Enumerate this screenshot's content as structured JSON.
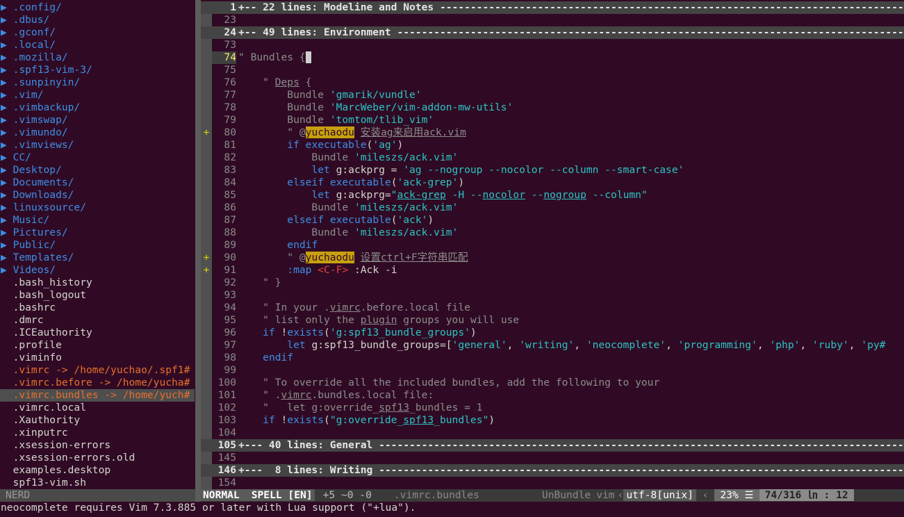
{
  "tree": [
    {
      "t": "▶ .config/",
      "k": "dir"
    },
    {
      "t": "▶ .dbus/",
      "k": "dir"
    },
    {
      "t": "▶ .gconf/",
      "k": "dir"
    },
    {
      "t": "▶ .local/",
      "k": "dir"
    },
    {
      "t": "▶ .mozilla/",
      "k": "dir"
    },
    {
      "t": "▶ .spf13-vim-3/",
      "k": "dir"
    },
    {
      "t": "▶ .sunpinyin/",
      "k": "dir"
    },
    {
      "t": "▶ .vim/",
      "k": "dir"
    },
    {
      "t": "▶ .vimbackup/",
      "k": "dir"
    },
    {
      "t": "▶ .vimswap/",
      "k": "dir"
    },
    {
      "t": "▶ .vimundo/",
      "k": "dir"
    },
    {
      "t": "▶ .vimviews/",
      "k": "dir"
    },
    {
      "t": "▶ CC/",
      "k": "dir"
    },
    {
      "t": "▶ Desktop/",
      "k": "dir"
    },
    {
      "t": "▶ Documents/",
      "k": "dir"
    },
    {
      "t": "▶ Downloads/",
      "k": "dir"
    },
    {
      "t": "▶ linuxsource/",
      "k": "dir"
    },
    {
      "t": "▶ Music/",
      "k": "dir"
    },
    {
      "t": "▶ Pictures/",
      "k": "dir"
    },
    {
      "t": "▶ Public/",
      "k": "dir"
    },
    {
      "t": "▶ Templates/",
      "k": "dir"
    },
    {
      "t": "▶ Videos/",
      "k": "dir"
    },
    {
      "t": "  .bash_history",
      "k": "file"
    },
    {
      "t": "  .bash_logout",
      "k": "file"
    },
    {
      "t": "  .bashrc",
      "k": "file"
    },
    {
      "t": "  .dmrc",
      "k": "file"
    },
    {
      "t": "  .ICEauthority",
      "k": "file"
    },
    {
      "t": "  .profile",
      "k": "file"
    },
    {
      "t": "  .viminfo",
      "k": "file"
    },
    {
      "t": "  .vimrc -> /home/yuchao/.spf1#",
      "k": "lnk"
    },
    {
      "t": "  .vimrc.before -> /home/yucha#",
      "k": "lnk"
    },
    {
      "t": "  .vimrc.bundles -> /home/yuch#",
      "k": "lnk sel"
    },
    {
      "t": "  .vimrc.local",
      "k": "file"
    },
    {
      "t": "  .Xauthority",
      "k": "file"
    },
    {
      "t": "  .xinputrc",
      "k": "file"
    },
    {
      "t": "  .xsession-errors",
      "k": "file"
    },
    {
      "t": "  .xsession-errors.old",
      "k": "file"
    },
    {
      "t": "  examples.desktop",
      "k": "file"
    },
    {
      "t": "  spf13-vim.sh",
      "k": "file"
    }
  ],
  "editor": [
    {
      "n": "1",
      "k": "fold",
      "s": "",
      "h": [
        [
          "+-- 22 lines: Modeline and Notes --------------------------------------------------------------------------------------------------------",
          ""
        ]
      ]
    },
    {
      "n": "23",
      "k": "",
      "s": "",
      "h": []
    },
    {
      "n": "24",
      "k": "fold",
      "s": "",
      "h": [
        [
          "+-- 49 lines: Environment ---------------------------------------------------------------------------------------------------------------",
          ""
        ]
      ]
    },
    {
      "n": "73",
      "k": "",
      "s": "",
      "h": []
    },
    {
      "n": "74",
      "k": "cur",
      "s": "",
      "h": [
        [
          "\" Bundles {",
          "cm"
        ],
        [
          " ",
          "cursor"
        ]
      ]
    },
    {
      "n": "75",
      "k": "",
      "s": "",
      "h": []
    },
    {
      "n": "76",
      "k": "",
      "s": "",
      "h": [
        [
          "    \" ",
          "cm"
        ],
        [
          "Deps",
          "cm ul"
        ],
        [
          " {",
          "cm"
        ]
      ]
    },
    {
      "n": "77",
      "k": "",
      "s": "",
      "h": [
        [
          "        Bundle ",
          "cm"
        ],
        [
          "'gmarik/vundle'",
          "st"
        ]
      ]
    },
    {
      "n": "78",
      "k": "",
      "s": "",
      "h": [
        [
          "        Bundle ",
          "cm"
        ],
        [
          "'MarcWeber/vim-addon-mw-utils'",
          "st"
        ]
      ]
    },
    {
      "n": "79",
      "k": "",
      "s": "",
      "h": [
        [
          "        Bundle ",
          "cm"
        ],
        [
          "'tomtom/tlib_vim'",
          "st"
        ]
      ]
    },
    {
      "n": "80",
      "k": "",
      "s": "+",
      "h": [
        [
          "        \" @",
          "cm"
        ],
        [
          "yuchaodu",
          "tag"
        ],
        [
          " ",
          "cm"
        ],
        [
          "安装ag来启用ack.vim",
          "cm ul"
        ]
      ]
    },
    {
      "n": "81",
      "k": "",
      "s": "",
      "h": [
        [
          "        ",
          ""
        ],
        [
          "if",
          "kw"
        ],
        [
          " ",
          ""
        ],
        [
          "executable",
          "kw"
        ],
        [
          "(",
          ""
        ],
        [
          "'ag'",
          "st"
        ],
        [
          ")",
          ""
        ]
      ]
    },
    {
      "n": "82",
      "k": "",
      "s": "",
      "h": [
        [
          "            Bundle ",
          "cm"
        ],
        [
          "'mileszs/ack.vim'",
          "st"
        ]
      ]
    },
    {
      "n": "83",
      "k": "",
      "s": "",
      "h": [
        [
          "            ",
          ""
        ],
        [
          "let",
          "kw"
        ],
        [
          " g:ackprg = ",
          ""
        ],
        [
          "'ag --nogroup --nocolor --column --smart-case'",
          "st"
        ]
      ]
    },
    {
      "n": "84",
      "k": "",
      "s": "",
      "h": [
        [
          "        ",
          ""
        ],
        [
          "elseif",
          "kw"
        ],
        [
          " ",
          ""
        ],
        [
          "executable",
          "kw"
        ],
        [
          "(",
          ""
        ],
        [
          "'ack-grep'",
          "st"
        ],
        [
          ")",
          ""
        ]
      ]
    },
    {
      "n": "85",
      "k": "",
      "s": "",
      "h": [
        [
          "            ",
          ""
        ],
        [
          "let",
          "kw"
        ],
        [
          " g:ackprg=",
          ""
        ],
        [
          "\"",
          "st"
        ],
        [
          "ack-grep",
          "st ul"
        ],
        [
          " -H --",
          "st"
        ],
        [
          "nocolor",
          "st ul"
        ],
        [
          " --",
          "st"
        ],
        [
          "nogroup",
          "st ul"
        ],
        [
          " --column\"",
          "st"
        ]
      ]
    },
    {
      "n": "86",
      "k": "",
      "s": "",
      "h": [
        [
          "            Bundle ",
          "cm"
        ],
        [
          "'mileszs/ack.vim'",
          "st"
        ]
      ]
    },
    {
      "n": "87",
      "k": "",
      "s": "",
      "h": [
        [
          "        ",
          ""
        ],
        [
          "elseif",
          "kw"
        ],
        [
          " ",
          ""
        ],
        [
          "executable",
          "kw"
        ],
        [
          "(",
          ""
        ],
        [
          "'ack'",
          "st"
        ],
        [
          ")",
          ""
        ]
      ]
    },
    {
      "n": "88",
      "k": "",
      "s": "",
      "h": [
        [
          "            Bundle ",
          "cm"
        ],
        [
          "'mileszs/ack.vim'",
          "st"
        ]
      ]
    },
    {
      "n": "89",
      "k": "",
      "s": "",
      "h": [
        [
          "        ",
          ""
        ],
        [
          "endif",
          "kw"
        ]
      ]
    },
    {
      "n": "90",
      "k": "",
      "s": "+",
      "h": [
        [
          "        \" @",
          "cm"
        ],
        [
          "yuchaodu",
          "tag"
        ],
        [
          " ",
          "cm"
        ],
        [
          "设置ctrl+F字符串匹配",
          "cm ul"
        ]
      ]
    },
    {
      "n": "91",
      "k": "",
      "s": "+",
      "h": [
        [
          "        ",
          ""
        ],
        [
          ":map",
          "kw"
        ],
        [
          " ",
          ""
        ],
        [
          "<C-F>",
          "key"
        ],
        [
          " :Ack -i",
          ""
        ]
      ]
    },
    {
      "n": "92",
      "k": "",
      "s": "",
      "h": [
        [
          "    \" }",
          "cm"
        ]
      ]
    },
    {
      "n": "93",
      "k": "",
      "s": "",
      "h": []
    },
    {
      "n": "94",
      "k": "",
      "s": "",
      "h": [
        [
          "    \" In your .",
          "cm"
        ],
        [
          "vimrc",
          "cm ul"
        ],
        [
          ".before.local file",
          "cm"
        ]
      ]
    },
    {
      "n": "95",
      "k": "",
      "s": "",
      "h": [
        [
          "    \" list only the ",
          "cm"
        ],
        [
          "plugin",
          "cm ul"
        ],
        [
          " groups you will use",
          "cm"
        ]
      ]
    },
    {
      "n": "96",
      "k": "",
      "s": "",
      "h": [
        [
          "    ",
          ""
        ],
        [
          "if",
          "kw"
        ],
        [
          " !",
          ""
        ],
        [
          "exists",
          "kw"
        ],
        [
          "(",
          ""
        ],
        [
          "'g:spf13_bundle_groups'",
          "st"
        ],
        [
          ")",
          ""
        ]
      ]
    },
    {
      "n": "97",
      "k": "",
      "s": "",
      "h": [
        [
          "        ",
          ""
        ],
        [
          "let",
          "kw"
        ],
        [
          " g:spf13_bundle_groups=[",
          ""
        ],
        [
          "'general'",
          "st"
        ],
        [
          ", ",
          ""
        ],
        [
          "'writing'",
          "st"
        ],
        [
          ", ",
          ""
        ],
        [
          "'neocomplete'",
          "st"
        ],
        [
          ", ",
          ""
        ],
        [
          "'programming'",
          "st"
        ],
        [
          ", ",
          ""
        ],
        [
          "'php'",
          "st"
        ],
        [
          ", ",
          ""
        ],
        [
          "'ruby'",
          "st"
        ],
        [
          ", ",
          ""
        ],
        [
          "'py#",
          "st"
        ]
      ]
    },
    {
      "n": "98",
      "k": "",
      "s": "",
      "h": [
        [
          "    ",
          ""
        ],
        [
          "endif",
          "kw"
        ]
      ]
    },
    {
      "n": "99",
      "k": "",
      "s": "",
      "h": []
    },
    {
      "n": "100",
      "k": "",
      "s": "",
      "h": [
        [
          "    \" To override all the included bundles, add the following to your",
          "cm"
        ]
      ]
    },
    {
      "n": "101",
      "k": "",
      "s": "",
      "h": [
        [
          "    \" .",
          "cm"
        ],
        [
          "vimrc",
          "cm ul"
        ],
        [
          ".bundles.local file:",
          "cm"
        ]
      ]
    },
    {
      "n": "102",
      "k": "",
      "s": "",
      "h": [
        [
          "    \"   let g:override_",
          "cm"
        ],
        [
          "spf13",
          "cm ul"
        ],
        [
          "_bundles = 1",
          "cm"
        ]
      ]
    },
    {
      "n": "103",
      "k": "",
      "s": "",
      "h": [
        [
          "    ",
          ""
        ],
        [
          "if",
          "kw"
        ],
        [
          " !",
          ""
        ],
        [
          "exists",
          "kw"
        ],
        [
          "(",
          ""
        ],
        [
          "\"g:override_",
          "st"
        ],
        [
          "spf13",
          "st ul"
        ],
        [
          "_bundles\"",
          "st"
        ],
        [
          ")",
          ""
        ]
      ]
    },
    {
      "n": "104",
      "k": "",
      "s": "",
      "h": []
    },
    {
      "n": "105",
      "k": "fold",
      "s": "",
      "h": [
        [
          "+--- 40 lines: General ------------------------------------------------------------------------------------------------------------------",
          ""
        ]
      ]
    },
    {
      "n": "145",
      "k": "",
      "s": "",
      "h": []
    },
    {
      "n": "146",
      "k": "fold",
      "s": "",
      "h": [
        [
          "+---  8 lines: Writing ------------------------------------------------------------------------------------------------------------------",
          ""
        ]
      ]
    },
    {
      "n": "154",
      "k": "",
      "s": "",
      "h": []
    }
  ],
  "statusbar": {
    "left": "NERD",
    "mode": "NORMAL",
    "spell": "SPELL [EN]",
    "changes": "+5 ~0 -0",
    "filename": ".vimrc.bundles",
    "func": "UnBundle",
    "filetype": "vim",
    "encoding": "utf-8[unix]",
    "percent": "23% ☰",
    "position": "74/316 ㏑ : 12"
  },
  "cmdline": "neocomplete requires Vim 7.3.885 or later with Lua support (\"+lua\")."
}
